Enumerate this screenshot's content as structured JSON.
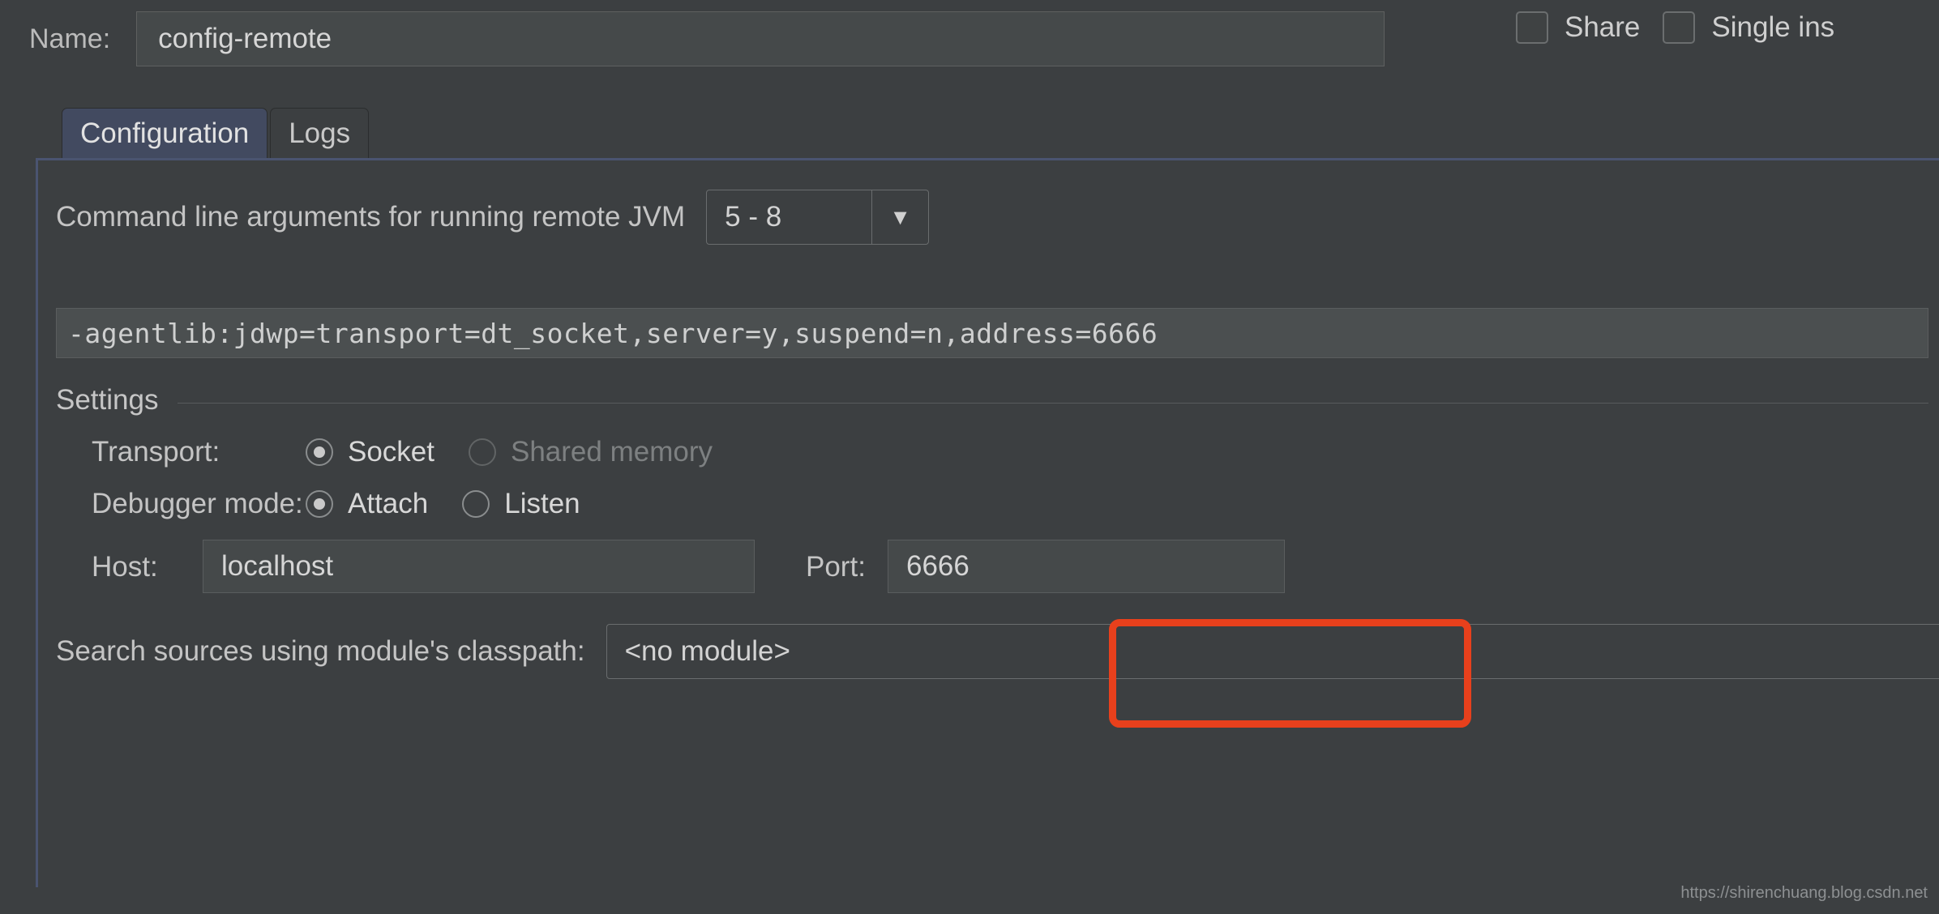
{
  "form": {
    "name_label": "Name:",
    "name_value": "config-remote",
    "share_label": "Share",
    "single_instance_label": "Single ins"
  },
  "tabs": [
    {
      "label": "Configuration",
      "active": true
    },
    {
      "label": "Logs",
      "active": false
    }
  ],
  "configuration": {
    "command_line_label": "Command line arguments for running remote JVM",
    "jvm_version_value": "5 - 8",
    "dropdown_arrow": "chevron-down-icon",
    "agentlib_value": "-agentlib:jdwp=transport=dt_socket,server=y,suspend=n,address=6666",
    "settings_title": "Settings",
    "transport": {
      "label": "Transport:",
      "options": [
        {
          "label": "Socket",
          "selected": true,
          "disabled": false
        },
        {
          "label": "Shared memory",
          "selected": false,
          "disabled": true
        }
      ]
    },
    "debugger_mode": {
      "label": "Debugger mode:",
      "options": [
        {
          "label": "Attach",
          "selected": true,
          "disabled": false
        },
        {
          "label": "Listen",
          "selected": false,
          "disabled": false
        }
      ]
    },
    "host": {
      "label": "Host:",
      "value": "localhost"
    },
    "port": {
      "label": "Port:",
      "value": "6666"
    },
    "search_sources": {
      "label": "Search sources using module's classpath:",
      "value": "<no module>"
    }
  },
  "annotation": {
    "highlight_color": "#e8401c",
    "target": "port-field"
  },
  "watermark": "https://shirenchuang.blog.csdn.net",
  "colors": {
    "background": "#3c3f41",
    "field_background": "#45494a",
    "active_tab": "#424a60",
    "text": "#c4c4c4",
    "disabled_text": "#7d8081"
  }
}
